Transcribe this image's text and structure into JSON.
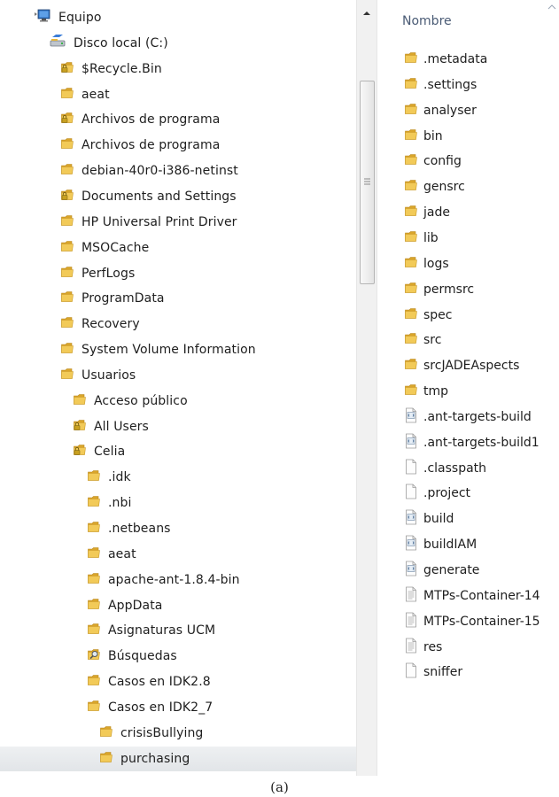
{
  "tree": {
    "items": [
      {
        "label": "Equipo",
        "icon": "computer-icon",
        "level": 0
      },
      {
        "label": "Disco local (C:)",
        "icon": "drive-icon",
        "level": 1
      },
      {
        "label": "$Recycle.Bin",
        "icon": "locked-folder-icon",
        "level": 2
      },
      {
        "label": "aeat",
        "icon": "folder-icon",
        "level": 2
      },
      {
        "label": "Archivos de programa",
        "icon": "locked-folder-icon",
        "level": 2
      },
      {
        "label": "Archivos de programa",
        "icon": "folder-icon",
        "level": 2
      },
      {
        "label": "debian-40r0-i386-netinst",
        "icon": "folder-icon",
        "level": 2
      },
      {
        "label": "Documents and Settings",
        "icon": "locked-folder-icon",
        "level": 2
      },
      {
        "label": "HP Universal Print Driver",
        "icon": "folder-icon",
        "level": 2
      },
      {
        "label": "MSOCache",
        "icon": "folder-icon",
        "level": 2
      },
      {
        "label": "PerfLogs",
        "icon": "folder-icon",
        "level": 2
      },
      {
        "label": "ProgramData",
        "icon": "folder-icon",
        "level": 2
      },
      {
        "label": "Recovery",
        "icon": "folder-icon",
        "level": 2
      },
      {
        "label": "System Volume Information",
        "icon": "folder-icon",
        "level": 2
      },
      {
        "label": "Usuarios",
        "icon": "folder-icon",
        "level": 2
      },
      {
        "label": "Acceso público",
        "icon": "folder-icon",
        "level": 3
      },
      {
        "label": "All Users",
        "icon": "locked-folder-icon",
        "level": 3
      },
      {
        "label": "Celia",
        "icon": "locked-folder-icon",
        "level": 3
      },
      {
        "label": ".idk",
        "icon": "folder-icon",
        "level": 4
      },
      {
        "label": ".nbi",
        "icon": "folder-icon",
        "level": 4
      },
      {
        "label": ".netbeans",
        "icon": "folder-icon",
        "level": 4
      },
      {
        "label": "aeat",
        "icon": "folder-icon",
        "level": 4
      },
      {
        "label": "apache-ant-1.8.4-bin",
        "icon": "folder-icon",
        "level": 4
      },
      {
        "label": "AppData",
        "icon": "folder-icon",
        "level": 4
      },
      {
        "label": "Asignaturas UCM",
        "icon": "folder-icon",
        "level": 4
      },
      {
        "label": "Búsquedas",
        "icon": "search-folder-icon",
        "level": 4
      },
      {
        "label": "Casos en IDK2.8",
        "icon": "folder-icon",
        "level": 4
      },
      {
        "label": "Casos en IDK2_7",
        "icon": "folder-icon",
        "level": 4
      },
      {
        "label": "crisisBullying",
        "icon": "folder-icon",
        "level": 5
      },
      {
        "label": "purchasing",
        "icon": "folder-icon",
        "level": 5,
        "selected": true
      }
    ]
  },
  "file_list": {
    "column_header": "Nombre",
    "items": [
      {
        "label": ".metadata",
        "icon": "folder-icon"
      },
      {
        "label": ".settings",
        "icon": "folder-icon"
      },
      {
        "label": "analyser",
        "icon": "folder-icon"
      },
      {
        "label": "bin",
        "icon": "folder-icon"
      },
      {
        "label": "config",
        "icon": "folder-icon"
      },
      {
        "label": "gensrc",
        "icon": "folder-icon"
      },
      {
        "label": "jade",
        "icon": "folder-icon"
      },
      {
        "label": "lib",
        "icon": "folder-icon"
      },
      {
        "label": "logs",
        "icon": "folder-icon"
      },
      {
        "label": "permsrc",
        "icon": "folder-icon"
      },
      {
        "label": "spec",
        "icon": "folder-icon"
      },
      {
        "label": "src",
        "icon": "folder-icon"
      },
      {
        "label": "srcJADEAspects",
        "icon": "folder-icon"
      },
      {
        "label": "tmp",
        "icon": "folder-icon"
      },
      {
        "label": ".ant-targets-build",
        "icon": "xml-file-icon"
      },
      {
        "label": ".ant-targets-build1",
        "icon": "xml-file-icon"
      },
      {
        "label": ".classpath",
        "icon": "blank-file-icon"
      },
      {
        "label": ".project",
        "icon": "blank-file-icon"
      },
      {
        "label": "build",
        "icon": "xml-file-icon"
      },
      {
        "label": "buildIAM",
        "icon": "xml-file-icon"
      },
      {
        "label": "generate",
        "icon": "xml-file-icon"
      },
      {
        "label": "MTPs-Container-14",
        "icon": "text-file-icon"
      },
      {
        "label": "MTPs-Container-15",
        "icon": "text-file-icon"
      },
      {
        "label": "res",
        "icon": "text-file-icon"
      },
      {
        "label": "sniffer",
        "icon": "blank-file-icon"
      }
    ]
  },
  "caption": "(a)",
  "colors": {
    "folder": "#e8b83c",
    "header_text": "#4a5b75",
    "selection": "#e4e7ea"
  }
}
